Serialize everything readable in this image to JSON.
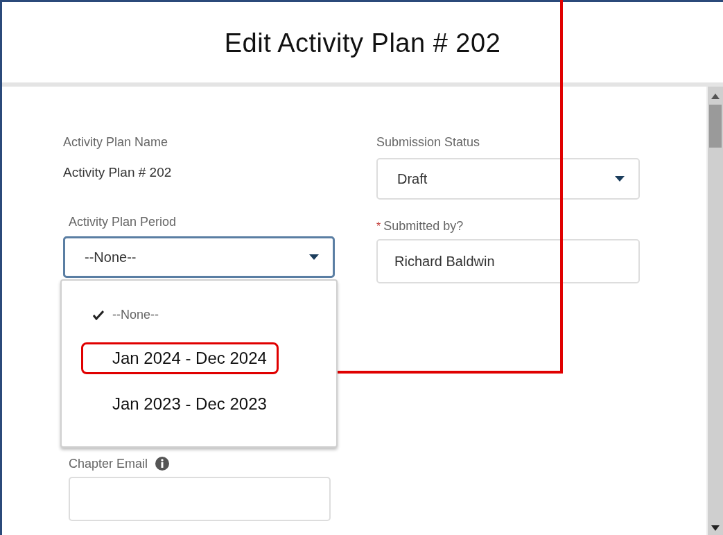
{
  "dialog": {
    "title": "Edit Activity Plan # 202"
  },
  "plan_name": {
    "label": "Activity Plan Name",
    "value": "Activity Plan # 202"
  },
  "submission_status": {
    "label": "Submission Status",
    "value": "Draft"
  },
  "period": {
    "label": "Activity Plan Period",
    "value": "--None--",
    "expanded": true,
    "options": [
      {
        "label": "--None--",
        "selected": true,
        "annotated": false
      },
      {
        "label": "Jan 2024 - Dec 2024",
        "selected": false,
        "annotated": true
      },
      {
        "label": "Jan 2023 - Dec 2023",
        "selected": false,
        "annotated": false
      }
    ]
  },
  "submitted_by": {
    "label": "Submitted by?",
    "required_mark": "*",
    "value": "Richard Baldwin"
  },
  "chapter_email": {
    "label": "Chapter Email"
  }
}
